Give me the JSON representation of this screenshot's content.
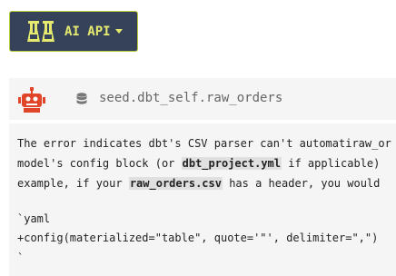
{
  "ai_api": {
    "label": "AI API",
    "icon": "flask-icon",
    "accent": "#e5ea6f",
    "background": "#354259"
  },
  "message": {
    "avatar_icon": "robot-icon",
    "avatar_color": "#e0452a",
    "source_icon": "database-icon",
    "source_label": "seed.dbt_self.raw_orders",
    "body": {
      "line1": "The error indicates dbt's CSV parser can't automatiraw_or",
      "line2_pre": "model's config block (or ",
      "line2_code": "dbt_project.yml",
      "line2_post": " if applicable)",
      "line3_pre": "example, if your ",
      "line3_code": "raw_orders.csv",
      "line3_post": " has a header, you would",
      "line5": "`yaml",
      "line6": "+config(materialized=\"table\", quote='\"', delimiter=\",\")",
      "line7": "`"
    }
  }
}
